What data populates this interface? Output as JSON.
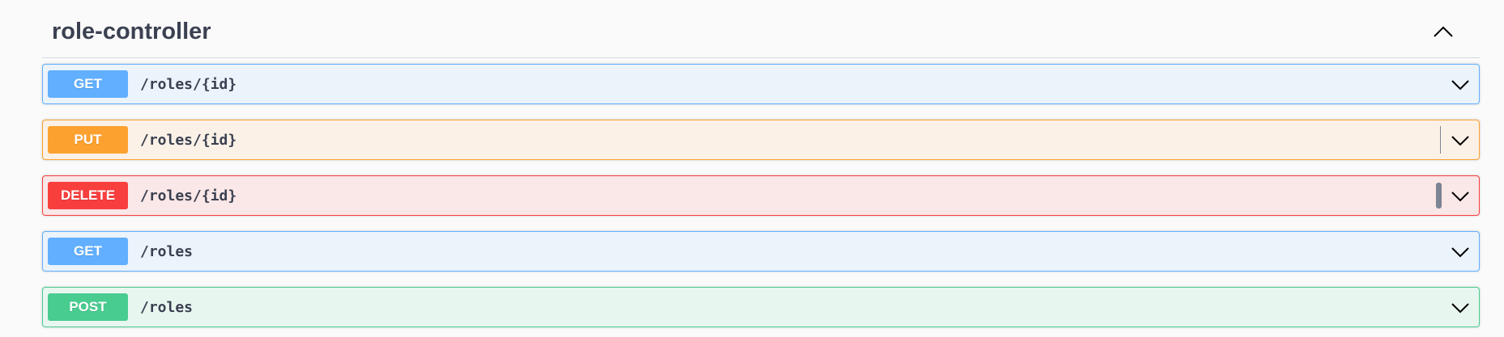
{
  "section": {
    "title": "role-controller",
    "collapse_icon": "chevron-up-icon"
  },
  "operations": [
    {
      "method": "GET",
      "path": "/roles/{id}",
      "color": "#61affe"
    },
    {
      "method": "PUT",
      "path": "/roles/{id}",
      "color": "#fca130"
    },
    {
      "method": "DELETE",
      "path": "/roles/{id}",
      "color": "#f93e3e"
    },
    {
      "method": "GET",
      "path": "/roles",
      "color": "#61affe"
    },
    {
      "method": "POST",
      "path": "/roles",
      "color": "#49cc90"
    }
  ],
  "expand_icon": "chevron-down-icon",
  "text_color": "#3b4151"
}
